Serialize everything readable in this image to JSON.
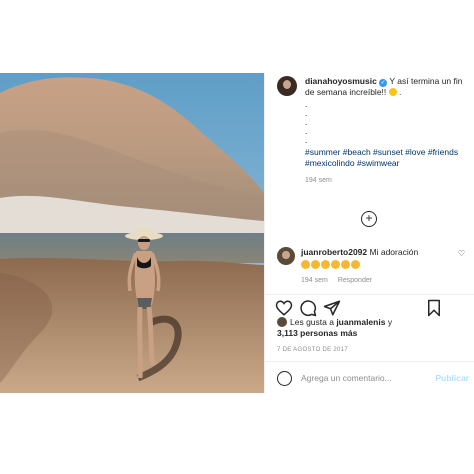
{
  "post": {
    "author": "dianahoyosmusic",
    "caption": "Y así termina un fin de semana increíble!!",
    "caption_dots": [
      ".",
      ".",
      ".",
      ".",
      "."
    ],
    "hashtags": "#summer #beach #sunset #love #friends #mexicolindo #swimwear",
    "time_ago": "194 sem"
  },
  "comment": {
    "author": "juanroberto2092",
    "text": "Mi adoración",
    "emoji_count": 6,
    "time_ago": "194 sem",
    "reply_label": "Responder"
  },
  "likes": {
    "prefix": "Les gusta a ",
    "user": "juanmalenis",
    "middle": " y",
    "count_text": "3,113 personas más"
  },
  "date": "7 DE AGOSTO DE 2017",
  "add_comment": {
    "placeholder": "Agrega un comentario...",
    "publish_label": "Publicar"
  },
  "icons": [
    "heart-icon",
    "comment-icon",
    "share-icon",
    "bookmark-icon",
    "more-comments-icon",
    "emoji-icon"
  ],
  "colors": {
    "link": "#003569",
    "verified": "#3897f0",
    "muted": "#8e8e8e",
    "publish": "#b2dffc"
  }
}
